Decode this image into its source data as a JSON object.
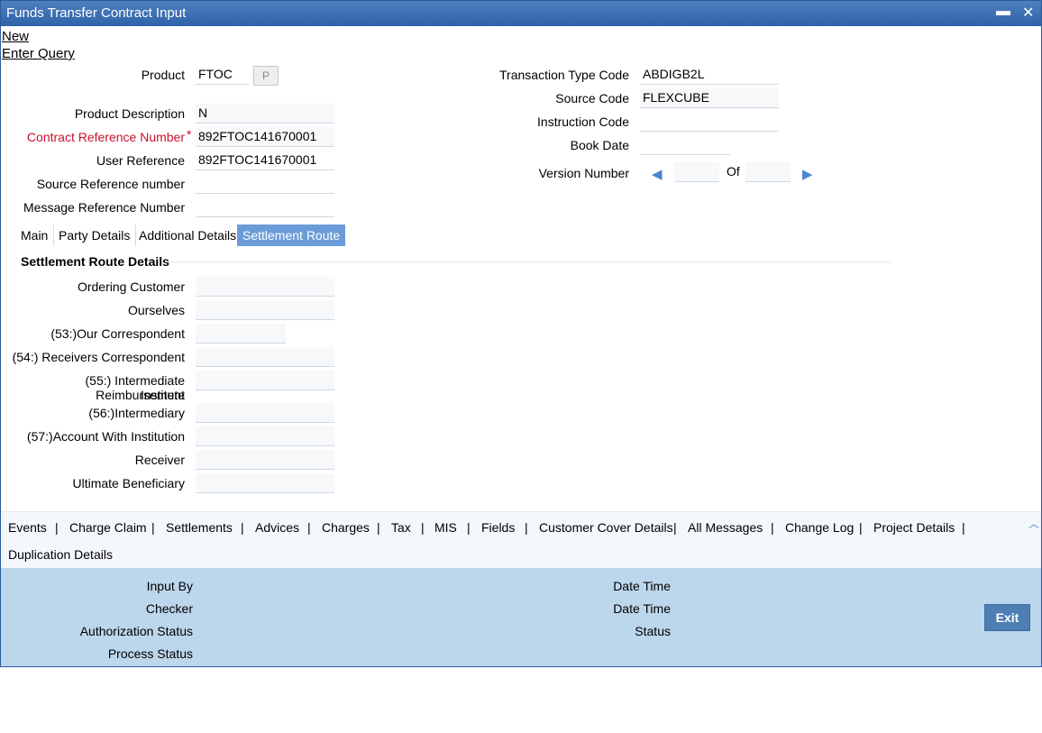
{
  "window": {
    "title": "Funds Transfer Contract Input",
    "minimize_glyph": "▬",
    "close_glyph": "✕"
  },
  "menu": {
    "new": "New",
    "enter_query": "Enter Query"
  },
  "header": {
    "product_label": "Product",
    "product_value": "FTOC",
    "product_button": "P",
    "product_description_label": "Product Description",
    "product_description_value": "N",
    "contract_ref_label": "Contract Reference Number",
    "contract_ref_value": "892FTOC141670001",
    "required_marker": "*",
    "user_ref_label": "User Reference",
    "user_ref_value": "892FTOC141670001",
    "source_ref_label": "Source Reference number",
    "source_ref_value": "",
    "message_ref_label": "Message Reference Number",
    "message_ref_value": "",
    "txn_type_label": "Transaction Type Code",
    "txn_type_value": "ABDIGB2L",
    "source_code_label": "Source Code",
    "source_code_value": "FLEXCUBE",
    "instruction_code_label": "Instruction Code",
    "instruction_code_value": "",
    "book_date_label": "Book Date",
    "book_date_value": "",
    "version_label": "Version Number",
    "version_value": "",
    "version_of": "Of",
    "version_total": ""
  },
  "tabs": [
    {
      "label": "Main"
    },
    {
      "label": "Party Details"
    },
    {
      "label": "Additional Details"
    },
    {
      "label": "Settlement Route"
    }
  ],
  "settlement": {
    "section_title": "Settlement Route Details",
    "fields": [
      {
        "label": "Ordering Customer",
        "value": ""
      },
      {
        "label": "Ourselves",
        "value": ""
      },
      {
        "label": "(53:)Our Correspondent",
        "value": ""
      },
      {
        "label": "(54:) Receivers Correspondent",
        "value": ""
      },
      {
        "label": "(55:) Intermediate Reimbursement",
        "label2": "Institute",
        "value": ""
      },
      {
        "label": "(56:)Intermediary",
        "value": ""
      },
      {
        "label": "(57:)Account With Institution",
        "value": ""
      },
      {
        "label": "Receiver",
        "value": ""
      },
      {
        "label": "Ultimate Beneficiary",
        "value": ""
      }
    ]
  },
  "footer_links": [
    "Events",
    "Charge Claim",
    "Settlements",
    "Advices",
    "Charges",
    "Tax",
    "MIS",
    "Fields",
    "Customer Cover Details",
    "All Messages",
    "Change Log",
    "Project Details",
    "Duplication Details"
  ],
  "footer_separator": "|",
  "audit": {
    "input_by": "Input By",
    "checker": "Checker",
    "authorization_status": "Authorization Status",
    "process_status": "Process Status",
    "date_time_1": "Date Time",
    "date_time_2": "Date Time",
    "status": "Status",
    "exit": "Exit"
  },
  "colors": {
    "titlebar": "#2f62a8",
    "active_tab": "#6b9bd8",
    "audit_panel": "#bcd6ec",
    "exit_button": "#4d7fb5",
    "required": "#c8102e"
  }
}
